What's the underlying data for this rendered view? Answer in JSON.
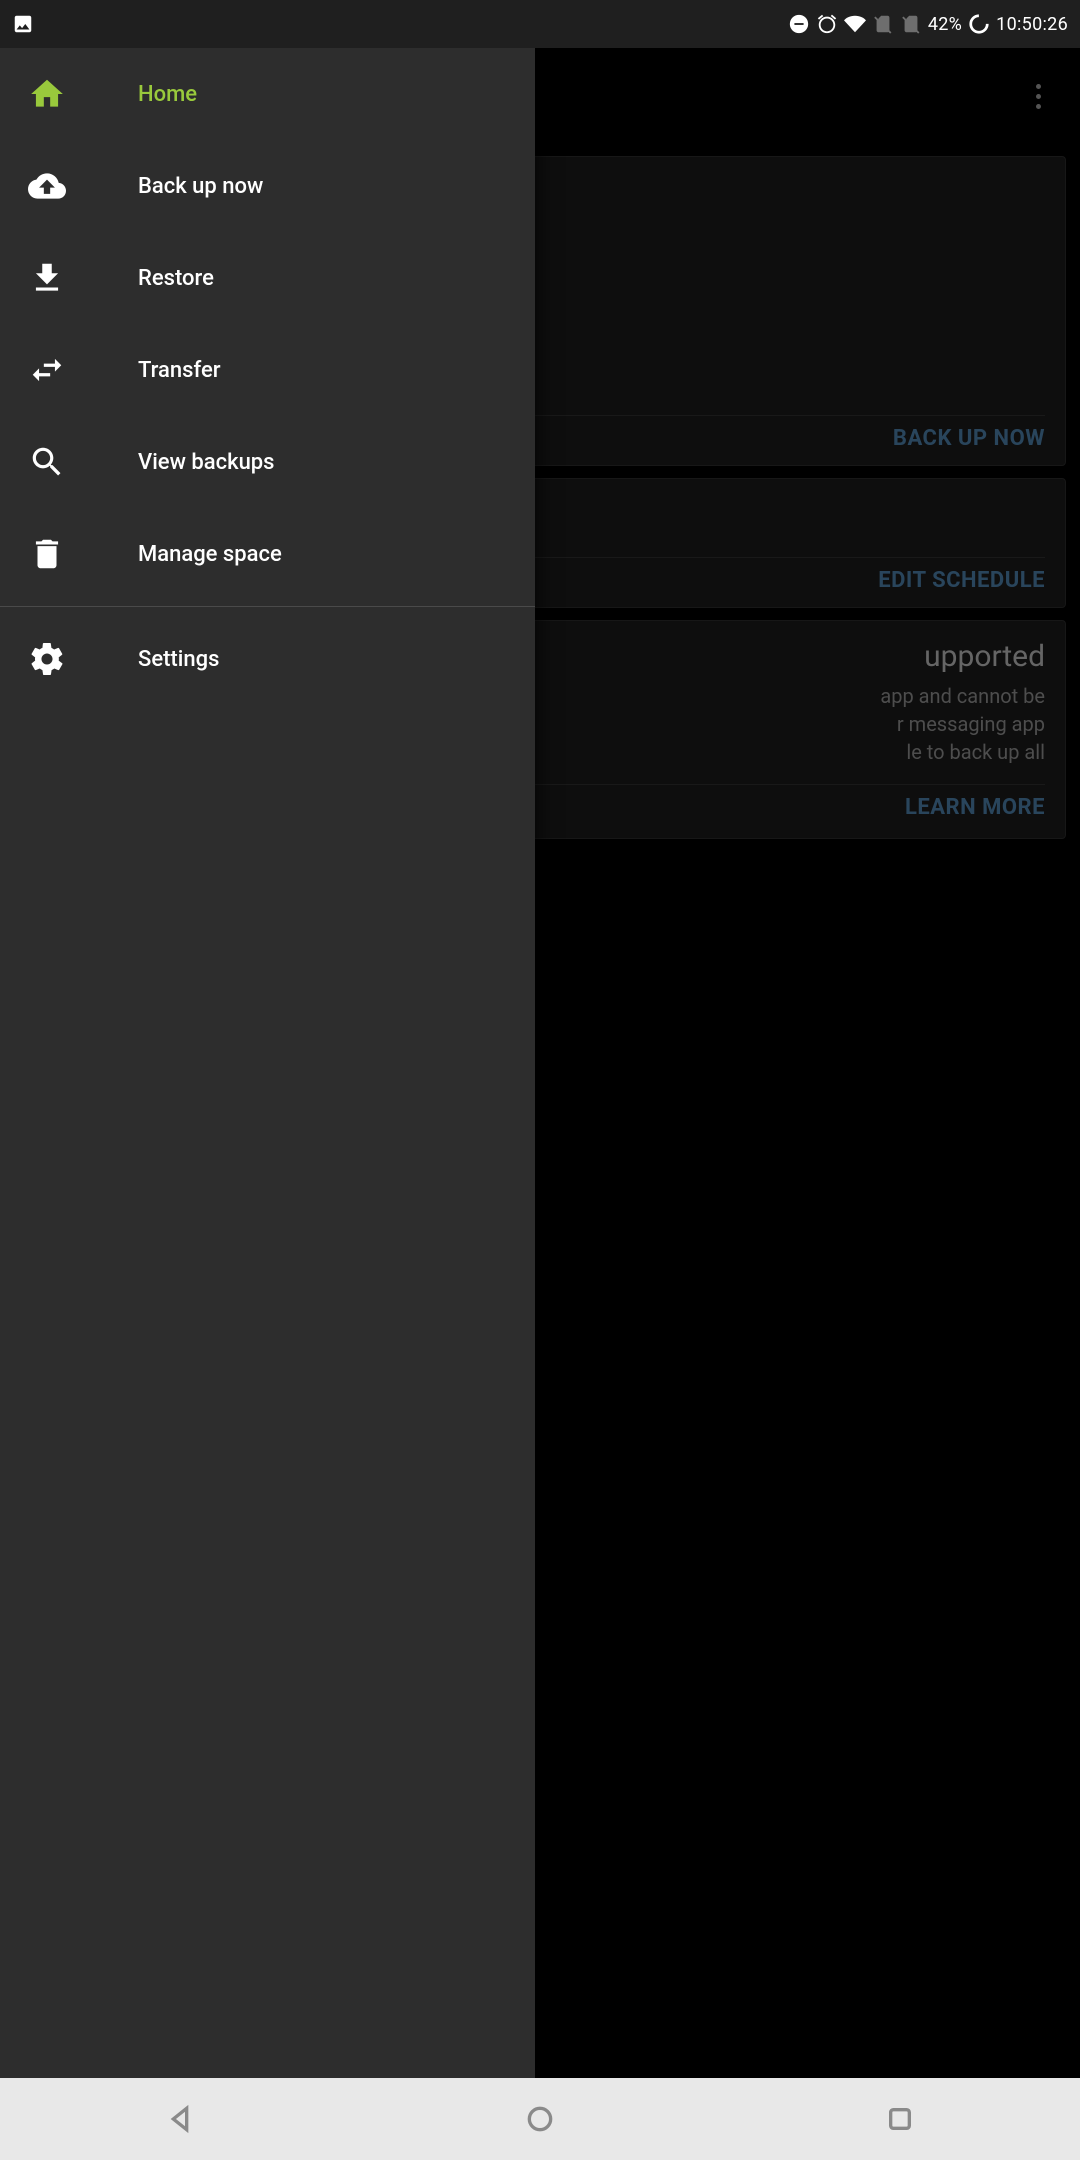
{
  "status": {
    "battery": "42%",
    "time": "10:50:26"
  },
  "drawer": {
    "items": [
      {
        "label": "Home",
        "icon": "home-icon",
        "active": true
      },
      {
        "label": "Back up now",
        "icon": "cloud-upload-icon"
      },
      {
        "label": "Restore",
        "icon": "download-icon"
      },
      {
        "label": "Transfer",
        "icon": "transfer-icon"
      },
      {
        "label": "View backups",
        "icon": "search-icon"
      },
      {
        "label": "Manage space",
        "icon": "trash-icon"
      }
    ],
    "secondary": [
      {
        "label": "Settings",
        "icon": "gear-icon"
      }
    ]
  },
  "cards": {
    "backup_now": {
      "action": "BACK UP NOW"
    },
    "schedule": {
      "action": "EDIT SCHEDULE"
    },
    "unsupported": {
      "title_fragment": "upported",
      "text_fragment_1": "app and cannot be",
      "text_fragment_2": "r messaging app",
      "text_fragment_3": "le to back up all",
      "action": "LEARN MORE"
    }
  },
  "colors": {
    "accent": "#99c93c",
    "link": "#4b7ea8"
  }
}
